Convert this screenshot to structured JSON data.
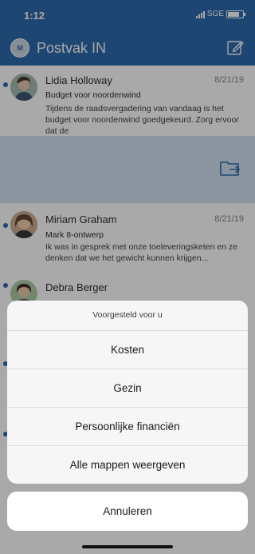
{
  "status_bar": {
    "time": "1:12",
    "carrier": "SGE"
  },
  "header": {
    "title": "Postvak IN",
    "avatar_initial": "M",
    "brand_color": "#1f5fa8"
  },
  "messages": [
    {
      "sender": "Lidia Holloway",
      "date": "8/21/19",
      "subject": "Budget voor noordenwind",
      "preview": "Tijdens de raadsvergadering van vandaag is het budget voor noordenwind goedgekeurd. Zorg ervoor dat de",
      "unread": true
    },
    {
      "sender": "Miriam Graham",
      "date": "8/21/19",
      "subject": "Mark 8-ontwerp",
      "preview": "Ik was in gesprek met onze toeleveringsketen en ze denken dat we het gewicht kunnen krijgen...",
      "unread": true
    },
    {
      "sender": "Debra Berger",
      "date": "",
      "subject": "",
      "preview": "",
      "unread": true
    }
  ],
  "swipe_action": {
    "icon": "move-folder-icon",
    "color": "#cfdff0"
  },
  "action_sheet": {
    "title": "Voorgesteld voor u",
    "options": [
      "Kosten",
      "Gezin",
      "Persoonlijke financiën",
      "Alle mappen weergeven"
    ],
    "cancel_label": "Annuleren"
  }
}
